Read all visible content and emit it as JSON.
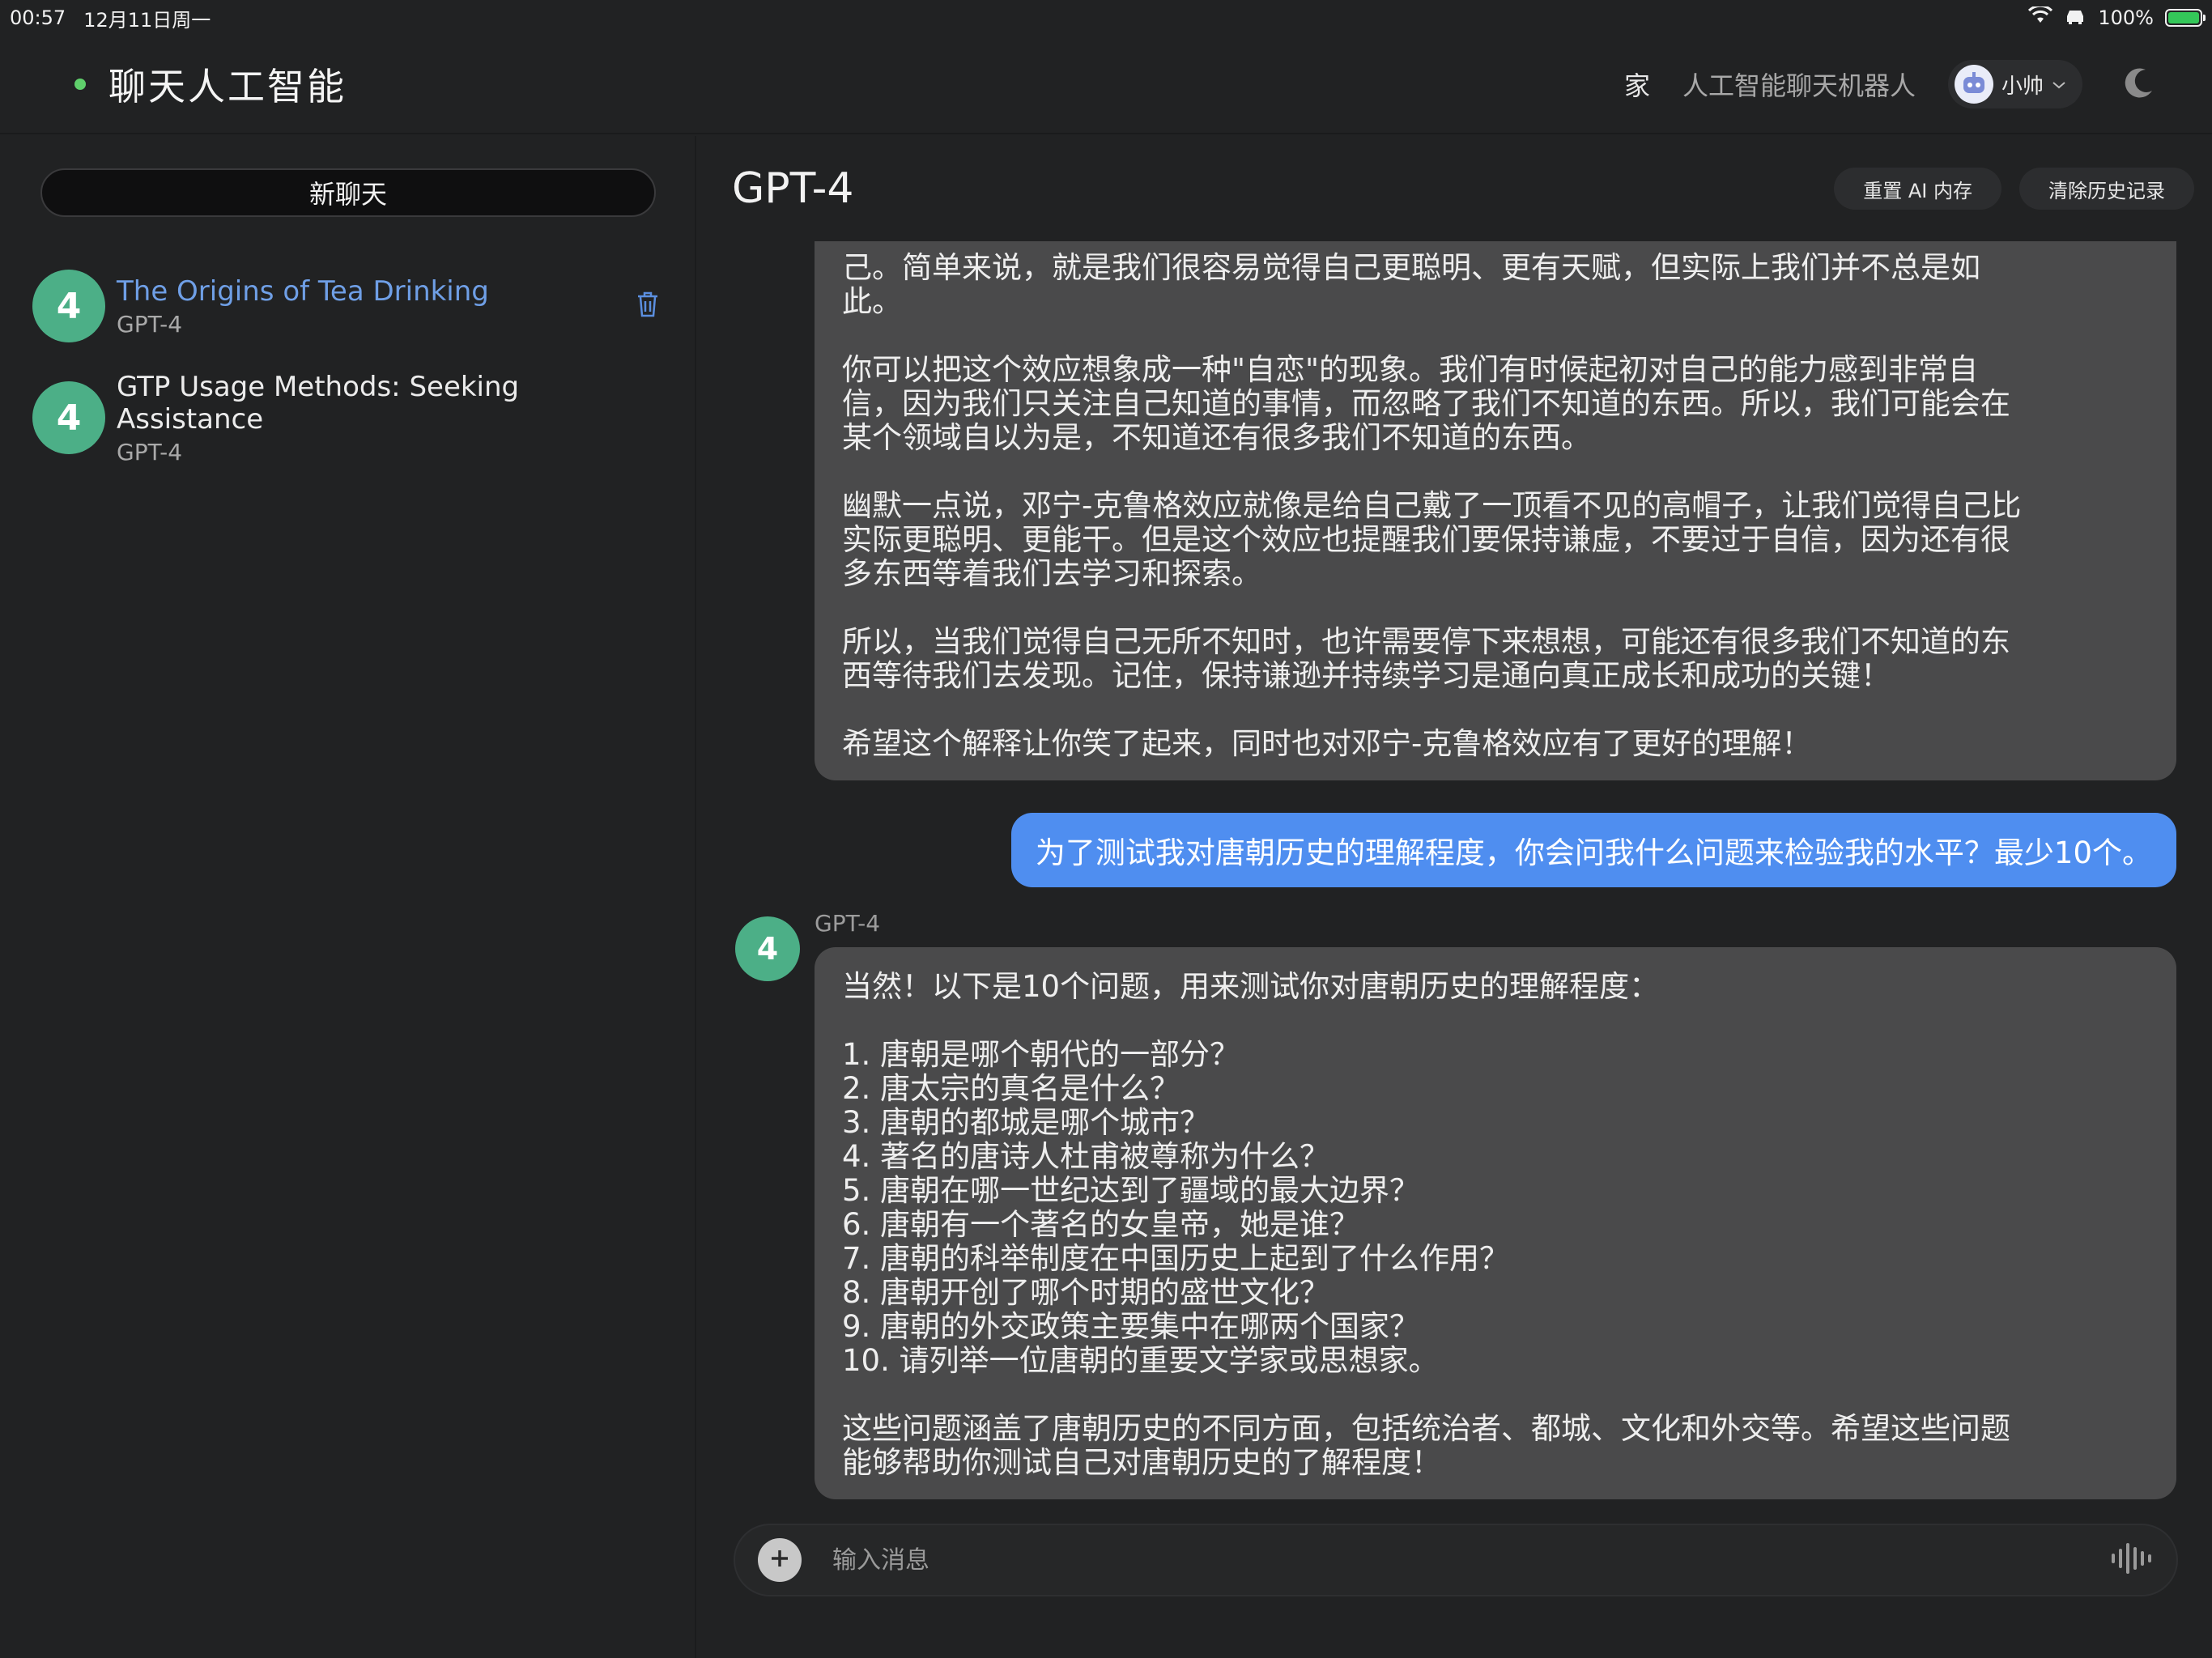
{
  "status_bar": {
    "time": "00:57",
    "date": "12月11日周一",
    "battery": "100%"
  },
  "nav": {
    "brand": "聊天人工智能",
    "home": "家",
    "chatbot": "人工智能聊天机器人",
    "user_name": "小帅"
  },
  "sidebar": {
    "new_chat": "新聊天",
    "conversations": [
      {
        "avatar": "4",
        "title": "The Origins of Tea Drinking",
        "model": "GPT-4"
      },
      {
        "avatar": "4",
        "title": "GTP Usage Methods: Seeking Assistance",
        "model": "GPT-4"
      }
    ]
  },
  "main": {
    "model_title": "GPT-4",
    "reset_memory": "重置 AI 内存",
    "clear_history": "清除历史记录",
    "messages": {
      "bot1_text": "己。简单来说，就是我们很容易觉得自己更聪明、更有天赋，但实际上我们并不总是如\n此。\n\n你可以把这个效应想象成一种\"自恋\"的现象。我们有时候起初对自己的能力感到非常自\n信，因为我们只关注自己知道的事情，而忽略了我们不知道的东西。所以，我们可能会在\n某个领域自以为是，不知道还有很多我们不知道的东西。\n\n幽默一点说，邓宁-克鲁格效应就像是给自己戴了一顶看不见的高帽子，让我们觉得自己比\n实际更聪明、更能干。但是这个效应也提醒我们要保持谦虚，不要过于自信，因为还有很\n多东西等着我们去学习和探索。\n\n所以，当我们觉得自己无所不知时，也许需要停下来想想，可能还有很多我们不知道的东\n西等待我们去发现。记住，保持谦逊并持续学习是通向真正成长和成功的关键！\n\n希望这个解释让你笑了起来，同时也对邓宁-克鲁格效应有了更好的理解！",
      "user_text": "为了测试我对唐朝历史的理解程度，你会问我什么问题来检验我的水平？最少10个。",
      "bot2_avatar": "4",
      "bot2_name": "GPT-4",
      "bot2_text": "当然！以下是10个问题，用来测试你对唐朝历史的理解程度：\n\n1. 唐朝是哪个朝代的一部分？\n2. 唐太宗的真名是什么？\n3. 唐朝的都城是哪个城市？\n4. 著名的唐诗人杜甫被尊称为什么？\n5. 唐朝在哪一世纪达到了疆域的最大边界？\n6. 唐朝有一个著名的女皇帝，她是谁？\n7. 唐朝的科举制度在中国历史上起到了什么作用？\n8. 唐朝开创了哪个时期的盛世文化？\n9. 唐朝的外交政策主要集中在哪两个国家？\n10. 请列举一位唐朝的重要文学家或思想家。\n\n这些问题涵盖了唐朝历史的不同方面，包括统治者、都城、文化和外交等。希望这些问题\n能够帮助你测试自己对唐朝历史的了解程度！"
    },
    "input_placeholder": "输入消息"
  }
}
